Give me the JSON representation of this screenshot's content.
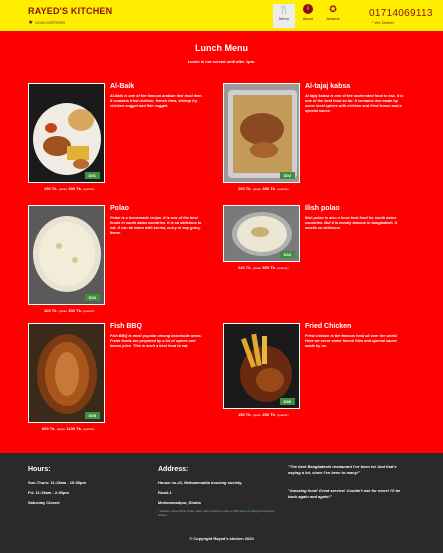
{
  "header": {
    "brand": "RAYED'S KITCHEN",
    "brand_sub": "DOUH CERTIFIED",
    "nav": [
      {
        "label": "Menu",
        "icon": "fork-knife-icon"
      },
      {
        "label": "About",
        "icon": "info-icon"
      },
      {
        "label": "Awards",
        "icon": "ribbon-icon"
      }
    ],
    "phone": "01714069113",
    "deliver": "* We Deliver"
  },
  "main": {
    "title": "Lunch Menu",
    "subtitle": "Lunch is not served until after 1pm."
  },
  "items": [
    {
      "name": "Al-Baik",
      "desc": "Al-Baik is one of the famous arabian fast food item. It contains fried chicken, french fries, shrimp fry, chicken nugget and fish nugget.",
      "badge": "D01",
      "price": "150 Tk.",
      "price_half": "(plate)",
      "price_full": "300 Tk.",
      "price_full_unit": "(quarter)"
    },
    {
      "name": "Al-tajaj kabsa",
      "desc": "Al tajaj kabsa is one of the underrated food in ksa. It is one of the best food so far. It contains rice made by some local spices with chicken and fried lemon and a special sauce.",
      "badge": "D02",
      "price": "200 Tk.",
      "price_half": "(plate)",
      "price_full": "380 Tk.",
      "price_full_unit": "(quarter)"
    },
    {
      "name": "Polao",
      "desc": "Polao is a homemade recipe. It is one of the best foods in south asian countries. It is so delicious to eat. It can be eaten with korma, curry or any gravy items.",
      "badge": "D03",
      "price": "100 Tk.",
      "price_half": "(plate)",
      "price_full": "300 Tk.",
      "price_full_unit": "(quarter)"
    },
    {
      "name": "Ilish polao",
      "desc": "Ilish polao is also a local best food for south asian countries. But it is mostly famous in bangladesh. It smells so delicious.",
      "badge": "D04",
      "price": "240 Tk.",
      "price_half": "(plate)",
      "price_full": "500 Tk.",
      "price_full_unit": "(quarter)"
    },
    {
      "name": "Fish BBQ",
      "desc": "Fish BBQ is most popular among beachside areas. Fresh foods are prepared by a lot of spices and lemon juice. This is such a best food to eat.",
      "badge": "D05",
      "price": "600 Tk.",
      "price_half": "(plate)",
      "price_full": "1100 Tk.",
      "price_full_unit": "(quarter)"
    },
    {
      "name": "Fried Chicken",
      "desc": "Fried chicken is the famous food all over the world. Here we serve some french fries and special sauce made by us.",
      "badge": "D06",
      "price": "150 Tk.",
      "price_half": "(plate)",
      "price_full": "250 Tk.",
      "price_full_unit": "(quarter)"
    }
  ],
  "footer": {
    "hours_title": "Hours:",
    "hours": [
      "Sun-Thurs: 11:15am - 10:00pm",
      "Fri: 11:15am - 2:30pm",
      "Saturday Closed"
    ],
    "address_title": "Address:",
    "address": [
      "House no-#2, Mohammadia housing society,",
      "Road-1",
      "Mohammadpur, Dhaka"
    ],
    "note": "* Delivery area within 5 kilo miles, with minimum order of 500 plus 20 charge for delivery orders.",
    "quote1": "\"The best Bangladeshi restaurant I've been to! And that's saying a lot, since I've been to many!\"",
    "quote2": "\"Amazing food! Great service! Couldn't ask for more! I'll be back again and again!\"",
    "copyright": "© Copyright Rayed's kitchen 2020"
  },
  "colors": {
    "header_bg": "#ffee00",
    "page_bg": "#ff0000",
    "brand": "#8a1010",
    "footer_bg": "#2a2a2a",
    "badge": "#3f8f3f"
  }
}
